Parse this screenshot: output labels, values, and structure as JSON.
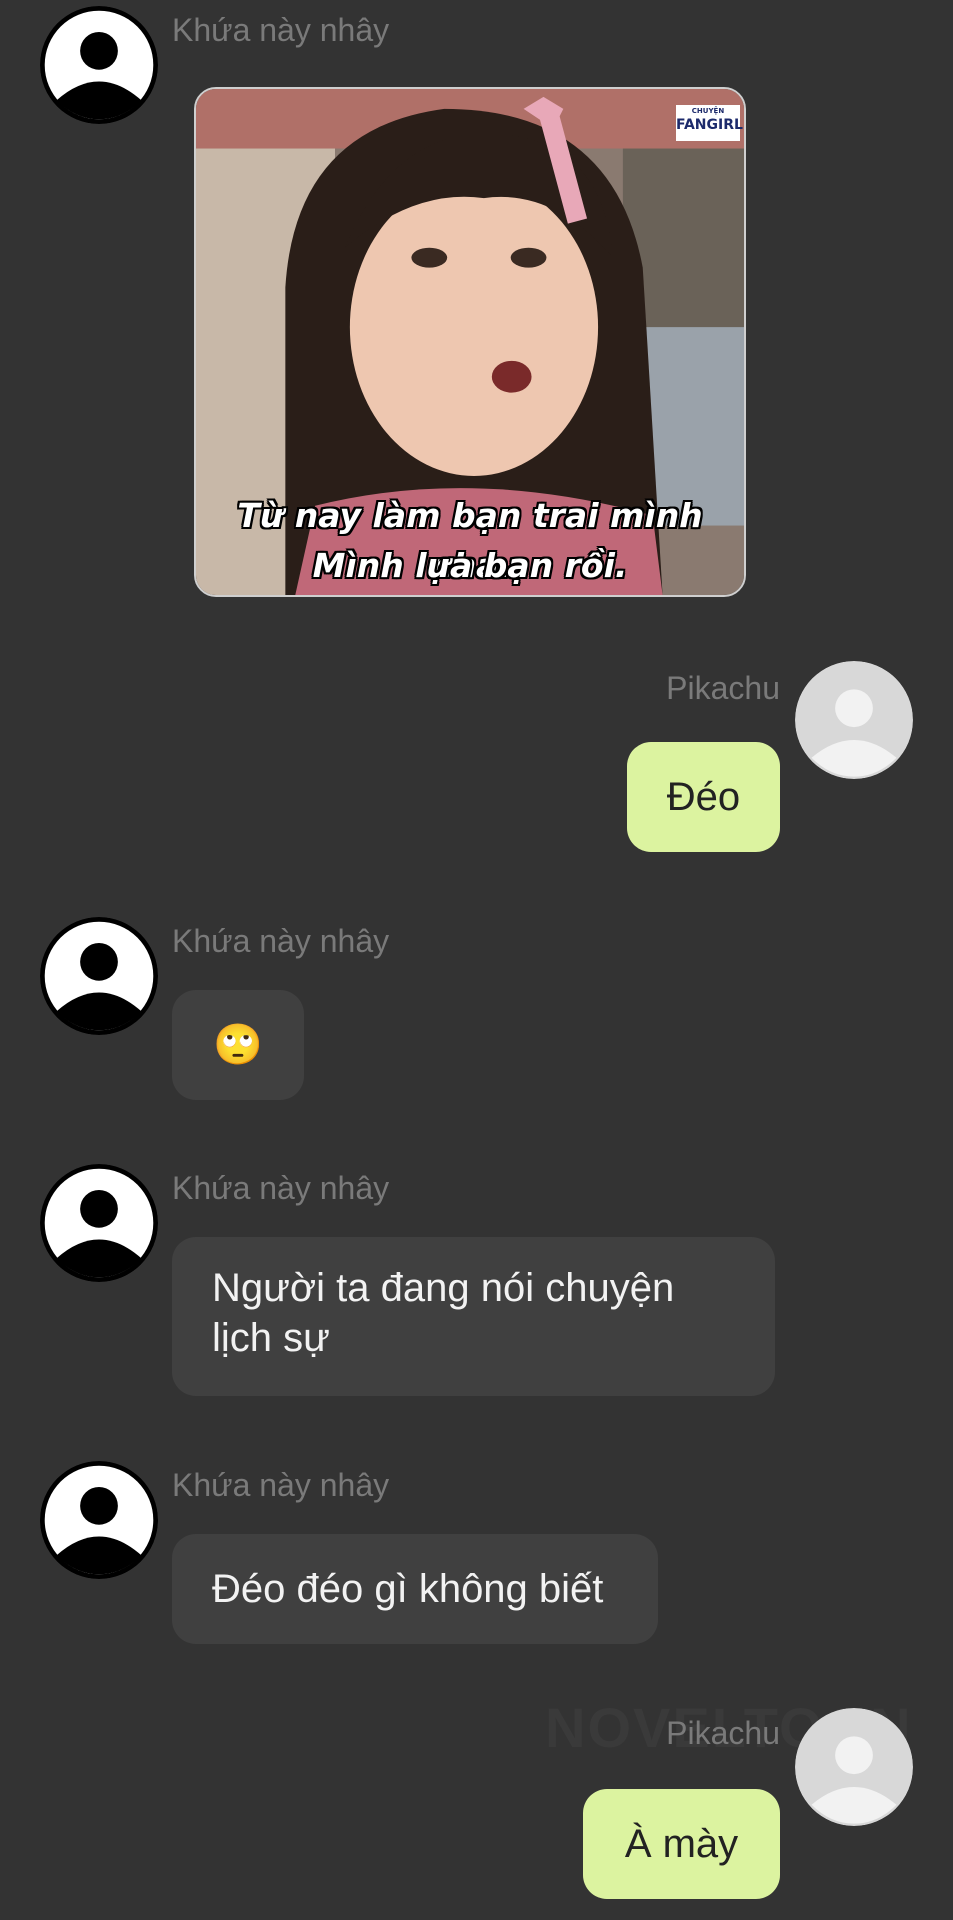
{
  "messages": [
    {
      "sender": "Khứa này nhây",
      "type": "image",
      "caption_line1": "Từ nay làm bạn trai mình nha.",
      "caption_line2": "Mình lựa bạn rồi.",
      "badge_small": "CHUYỆN",
      "badge_big": "FANGIRL"
    },
    {
      "sender": "Pikachu",
      "type": "text",
      "text": "Đéo"
    },
    {
      "sender": "Khứa này nhây",
      "type": "text",
      "text": "🙄"
    },
    {
      "sender": "Khứa này nhây",
      "type": "text",
      "text": "Người ta đang nói chuyện\nlịch sự"
    },
    {
      "sender": "Khứa này nhây",
      "type": "text",
      "text": "Đéo đéo gì không biết"
    },
    {
      "sender": "Pikachu",
      "type": "text",
      "text": "À mày"
    }
  ],
  "watermark": "NOVELTOON",
  "icons": {
    "other_avatar": "user-avatar-icon",
    "self_avatar": "user-avatar-icon"
  },
  "colors": {
    "background": "#333333",
    "other_bubble": "#404040",
    "self_bubble": "#dcf3a0",
    "name": "#7a7a7a"
  }
}
